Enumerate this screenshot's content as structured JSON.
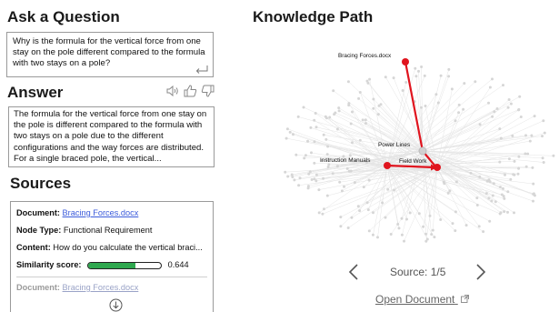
{
  "question_panel": {
    "title": "Ask a Question",
    "question_text": "Why is the formula for the vertical force from one stay on the pole different compared to the formula with two stays on a pole?",
    "submit_icon": "enter-return-icon"
  },
  "answer_panel": {
    "title": "Answer",
    "answer_text": "The formula for the vertical force from one stay on the pole is different compared to the formula with two stays on a pole due to the different configurations and the way forces are distributed. For a single braced pole, the vertical...",
    "icons": [
      "speaker-icon",
      "thumbs-up-icon",
      "thumbs-down-icon"
    ]
  },
  "sources_panel": {
    "title": "Sources",
    "document_label": "Document:",
    "document_link": "Bracing Forces.docx",
    "node_type_label": "Node Type:",
    "node_type_value": "Functional Requirement",
    "content_label": "Content:",
    "content_value": "How do you calculate the vertical braci...",
    "similarity_label": "Similarity score:",
    "similarity_value": "0.644",
    "similarity_fraction": 0.644,
    "next_document_label": "Document:",
    "next_document_link": "Bracing Forces.docx",
    "more_icon": "circle-arrow-down-icon"
  },
  "knowledge_path": {
    "title": "Knowledge Path",
    "nodes": [
      "Bracing Forces.docx",
      "Power Lines",
      "Instruction Manuals",
      "Field Work"
    ],
    "source_label": "Source: 1/5",
    "prev_icon": "chevron-left-icon",
    "next_icon": "chevron-right-icon",
    "open_document": "Open Document",
    "external_icon": "external-link-icon",
    "path_color": "#e0141e",
    "background_node_color": "#d6d6d6"
  }
}
